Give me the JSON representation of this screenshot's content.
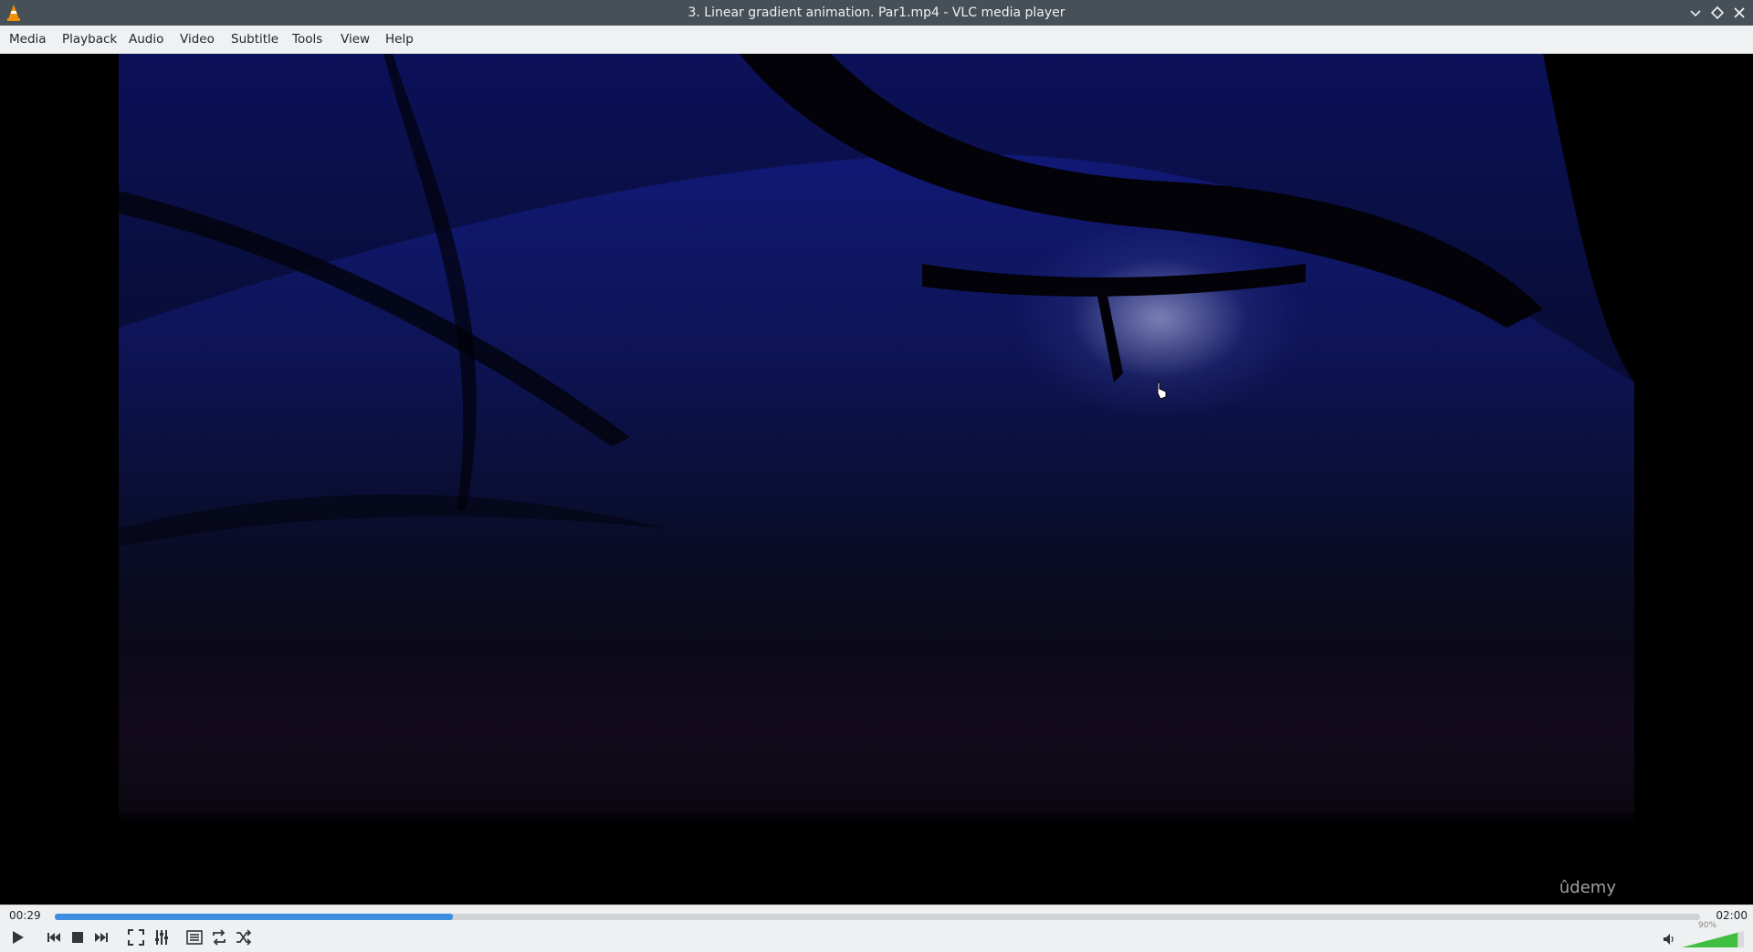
{
  "window": {
    "title": "3. Linear gradient animation. Par1.mp4 - VLC media player",
    "app_icon": "vlc-cone-icon"
  },
  "menu": {
    "items": [
      "Media",
      "Playback",
      "Audio",
      "Video",
      "Subtitle",
      "Tools",
      "View",
      "Help"
    ]
  },
  "video": {
    "watermark": "ûdemy"
  },
  "playback": {
    "elapsed": "00:29",
    "total": "02:00",
    "progress_fraction": 0.242
  },
  "volume": {
    "label": "90%",
    "level_fraction": 0.9
  },
  "controls": {
    "icons": [
      "play-icon",
      "previous-icon",
      "stop-icon",
      "next-icon",
      "fullscreen-icon",
      "extended-settings-icon",
      "playlist-icon",
      "loop-icon",
      "shuffle-icon",
      "speaker-icon"
    ]
  },
  "colors": {
    "accent": "#3d8ee0",
    "volume": "#3fbf3f",
    "titlebar": "#475057"
  }
}
